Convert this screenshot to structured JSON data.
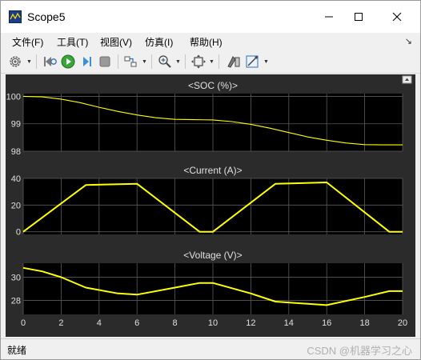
{
  "window": {
    "title": "Scope5"
  },
  "menu": {
    "items": [
      "文件(F)",
      "工具(T)",
      "视图(V)",
      "仿真(I)",
      "帮助(H)"
    ]
  },
  "toolbar": {
    "buttons": [
      "gear-icon",
      "step-back-icon",
      "run-icon",
      "step-forward-icon",
      "stop-icon",
      "highlight-block-icon",
      "zoom-icon",
      "autoscale-icon",
      "style-icon",
      "measure-icon"
    ]
  },
  "status": {
    "text": "就绪",
    "watermark": "CSDN @机器学习之心"
  },
  "colors": {
    "plot_bg": "#000000",
    "figure_bg": "#2b2b2b",
    "trace": "#ffff00",
    "grid": "#5a5a5a",
    "text": "#e0e0e0"
  },
  "chart_data": [
    {
      "type": "line",
      "title": "<SOC (%)>",
      "xlim": [
        0,
        20
      ],
      "ylim": [
        98,
        100.1
      ],
      "yticks": [
        98,
        99,
        100
      ],
      "xticks": [],
      "series": [
        {
          "x": [
            0,
            1,
            2,
            3,
            4,
            5,
            6,
            7,
            8,
            9,
            10,
            11,
            12,
            13,
            14,
            15,
            16,
            17,
            18,
            19,
            20
          ],
          "y": [
            100,
            99.98,
            99.9,
            99.77,
            99.6,
            99.45,
            99.32,
            99.22,
            99.16,
            99.15,
            99.14,
            99.08,
            98.98,
            98.84,
            98.68,
            98.52,
            98.4,
            98.3,
            98.24,
            98.23,
            98.23
          ]
        }
      ]
    },
    {
      "type": "line",
      "title": "<Current (A)>",
      "xlim": [
        0,
        20
      ],
      "ylim": [
        -2,
        40
      ],
      "yticks": [
        0,
        20,
        40
      ],
      "xticks": [],
      "series": [
        {
          "x": [
            0,
            3.3,
            6,
            9.3,
            10,
            13.3,
            16,
            19.3,
            20
          ],
          "y": [
            0,
            35,
            36,
            0,
            0,
            36,
            37,
            0,
            0
          ]
        }
      ]
    },
    {
      "type": "line",
      "title": "<Voltage (V)>",
      "xlim": [
        0,
        20
      ],
      "ylim": [
        26.8,
        31.2
      ],
      "yticks": [
        28,
        30
      ],
      "xticks": [
        0,
        2,
        4,
        6,
        8,
        10,
        12,
        14,
        16,
        18,
        20
      ],
      "series": [
        {
          "x": [
            0,
            1,
            2,
            3.3,
            5,
            6,
            8,
            9.3,
            10,
            12,
            13.3,
            16,
            18,
            19.3,
            20
          ],
          "y": [
            30.8,
            30.5,
            30,
            29.1,
            28.6,
            28.5,
            29.1,
            29.5,
            29.5,
            28.6,
            27.9,
            27.6,
            28.3,
            28.8,
            28.8
          ]
        }
      ]
    }
  ]
}
